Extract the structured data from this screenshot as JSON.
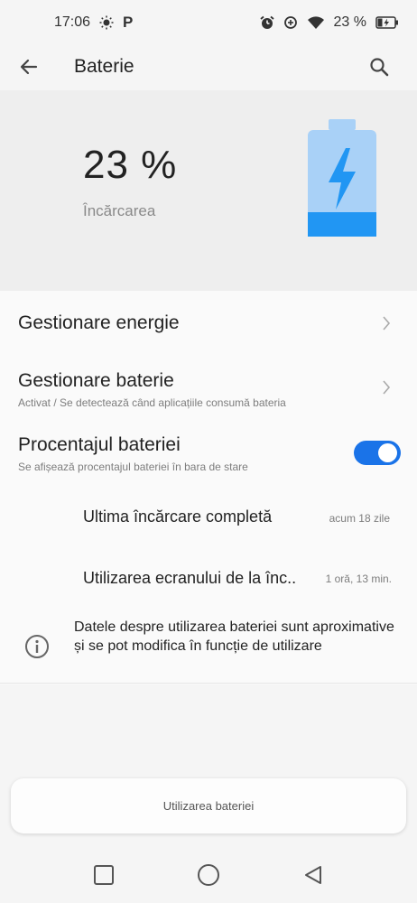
{
  "status_bar": {
    "time": "17:06",
    "battery_text": "23 %",
    "icons": [
      "brightness-icon",
      "parking-icon",
      "alarm-icon",
      "data-saver-icon",
      "wifi-icon",
      "battery-charging-icon"
    ],
    "p_glyph": "P"
  },
  "app_bar": {
    "title": "Baterie"
  },
  "hero": {
    "percent": "23 %",
    "status": "Încărcarea",
    "battery_level": 0.23,
    "accent_color": "#2196f3",
    "light_color": "#a9d1f7"
  },
  "list": {
    "energy_management": {
      "title": "Gestionare energie"
    },
    "battery_management": {
      "title": "Gestionare baterie",
      "subtitle": "Activat / Se detectează când aplicațiile consumă bateria"
    },
    "battery_percentage": {
      "title": "Procentajul bateriei",
      "subtitle": "Se afișează procentajul bateriei în bara de stare",
      "enabled": true
    },
    "last_full_charge": {
      "label": "Ultima încărcare completă",
      "value": "acum 18 zile"
    },
    "screen_usage": {
      "label": "Utilizarea ecranului de la înc..",
      "value": "1 oră, 13 min."
    },
    "info": {
      "text": "Datele despre utilizarea bateriei sunt aproximative și se pot modifica în funcție de utilizare"
    }
  },
  "usage_button": {
    "label": "Utilizarea bateriei"
  },
  "nav": {
    "buttons": [
      "recents-button",
      "home-button",
      "back-button"
    ]
  },
  "colors": {
    "toggle_on": "#1a73e8"
  }
}
